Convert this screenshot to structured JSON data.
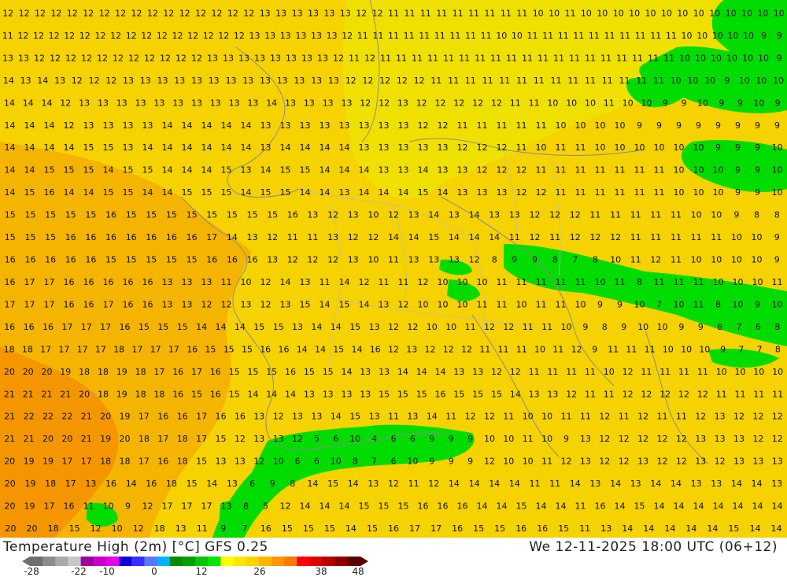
{
  "footer": {
    "title": "Temperature High (2m) [°C] GFS 0.25",
    "datetime": "We 12-11-2025 18:00 UTC (06+12)"
  },
  "colorbar": {
    "ticks": [
      "-28",
      "-22",
      "-10",
      "0",
      "12",
      "26",
      "38",
      "48"
    ],
    "colors": [
      "#6e6e6e",
      "#8c8c8c",
      "#aaaaaa",
      "#c8c8c8",
      "#a000a0",
      "#c800c8",
      "#e600e6",
      "#1400d2",
      "#3232ff",
      "#5a78ff",
      "#00b4ff",
      "#008c00",
      "#00a000",
      "#00c800",
      "#00e600",
      "#ffff00",
      "#ffe600",
      "#ffd200",
      "#ffb400",
      "#ff9600",
      "#ff7800",
      "#ff0000",
      "#dc0000",
      "#b40000",
      "#8c0000",
      "#5a0000"
    ]
  },
  "legend_colors": {
    "warm_12_up": "#f5d200",
    "warm_16_up": "#f5b400",
    "warm_20_up": "#f59600",
    "cool_below_11": "#00dc00"
  },
  "grid_rows": [
    "12 12 12 12 12 12 12 12 12 12 12 12 12 12 12 12 13 13 13 13 13 13 12 12 11 11 11 11 11 11 11 11 11 10 10 11 10 10 10 10 10 10 10 10 10 10 10 10 10",
    "11 12 12 12 12 12 12 12 12 12 12 12 12 12 12 12 13 13 13 13 13 13 12 11 11 11 11 11 11 11 11 11 10 10 11 11 11 11 11 11 11 11 11 11 10 10 10 10 10 9 9",
    "13 13 12 12 12 12 12 12 12 12 12 12 12 13 13 13 13 13 13 13 13 12 11 12 11 11 11 11 11 11 11 11 11 11 11 11 11 11 11 11 11 11 11 10 10 10 10 10 10 9",
    "14 13 14 13 12 12 12 13 13 13 13 13 13 13 13 13 13 13 13 13 12 12 12 12 12 11 11 11 11 11 11 11 11 11 11 11 11 11 11 10 10 10 9 10 10 10",
    "14 14 14 12 13 13 13 13 13 13 13 13 13 13 14 13 13 13 13 12 12 13 12 12 12 12 12 11 11 10 10 10 11 10 10 9 9 10 9 9 10 9",
    "14 14 14 12 13 13 13 13 14 14 14 14 14 13 13 13 13 13 13 13 13 12 12 11 11 11 11 11 10 10 10 10 9 9 9 9 9 9 9 9",
    "14 14 14 14 15 15 13 14 14 14 14 14 14 13 14 14 14 14 13 13 13 13 13 12 12 12 11 10 11 11 10 10 10 10 10 10 9 9 9 10",
    "14 14 15 15 15 14 15 15 14 14 14 15 13 14 15 15 14 14 14 13 13 14 13 13 12 12 12 11 11 11 11 11 11 11 10 10 10 9 9 10",
    "14 15 16 14 14 15 15 14 14 15 15 15 14 15 15 14 14 13 14 14 14 15 14 13 13 13 12 12 11 11 11 11 11 11 10 10 10 9 9 10",
    "15 15 15 15 15 16 15 15 15 15 15 15 15 15 16 13 12 13 10 12 13 14 13 14 13 13 12 12 12 11 11 11 11 11 10 10 9 8 8",
    "15 15 15 16 16 16 16 16 16 16 17 14 13 12 11 11 13 12 12 14 14 15 14 14 14 11 12 11 12 12 12 11 11 11 11 11 10 10 9",
    "16 16 16 16 16 15 15 15 15 15 16 16 16 13 12 12 12 13 10 11 13 13 13 12 8 9 9 8 7 8 10 11 12 11 10 10 10 10 9",
    "16 17 17 16 16 16 16 16 13 13 13 11 10 12 14 13 11 14 12 11 11 12 10 10 10 11 11 11 11 11 10 11 8 11 11 11 10 10 10 11",
    "17 17 17 16 16 17 16 16 13 13 12 12 13 12 13 15 14 15 14 13 12 10 10 10 11 11 10 11 11 10 9 9 10 7 10 11 8 10 9 10",
    "16 16 16 17 17 17 16 15 15 15 14 14 14 15 15 13 14 14 15 13 12 12 10 10 11 12 12 11 11 10 9 8 9 10 10 9 9 8 7 6 8",
    "18 18 17 17 17 17 18 17 17 17 16 15 15 15 16 16 14 14 15 14 16 12 13 12 12 12 11 11 11 10 11 12 9 11 11 11 10 10 10 9 7 7 8",
    "20 20 20 19 18 18 19 18 17 16 17 16 15 15 15 16 15 15 14 13 13 14 14 14 13 13 12 12 11 11 11 11 10 12 11 11 11 11 10 10 10 10",
    "21 21 21 21 20 18 19 18 18 16 15 16 15 14 14 14 13 13 13 13 15 15 15 16 15 15 15 14 13 13 12 11 11 12 12 12 12 12 11 11 11 11",
    "21 22 22 22 21 20 19 17 16 16 17 16 16 13 12 13 13 14 15 13 11 13 14 11 12 12 11 10 10 11 11 12 11 12 11 11 12 13 12 12 12",
    "21 21 20 20 21 19 20 18 17 18 17 15 12 13 13 12 5 6 10 4 6 6 9 9 9 10 10 11 10 9 13 12 12 12 12 12 13 13 13 12 12",
    "20 19 19 17 17 18 18 17 16 18 15 13 13 12 10 6 6 10 8 7 6 10 9 9 9 12 10 10 11 12 13 12 12 13 12 12 13 12 13 13 13",
    "20 19 18 17 13 16 14 16 18 15 14 13 6 9 8 14 15 14 13 12 11 12 14 14 14 14 11 11 14 13 14 13 14 14 13 13 14 14 13",
    "20 19 17 16 11 10 9 12 17 17 17 13 8 5 12 14 14 14 15 15 15 16 16 16 14 14 15 14 14 11 16 14 15 14 14 14 14 14 14 14",
    "20 20 18 15 12 10 12 18 13 11 9 7 16 15 15 15 14 15 16 17 17 16 15 15 16 16 15 11 13 14 14 14 14 14 15 14 14"
  ]
}
